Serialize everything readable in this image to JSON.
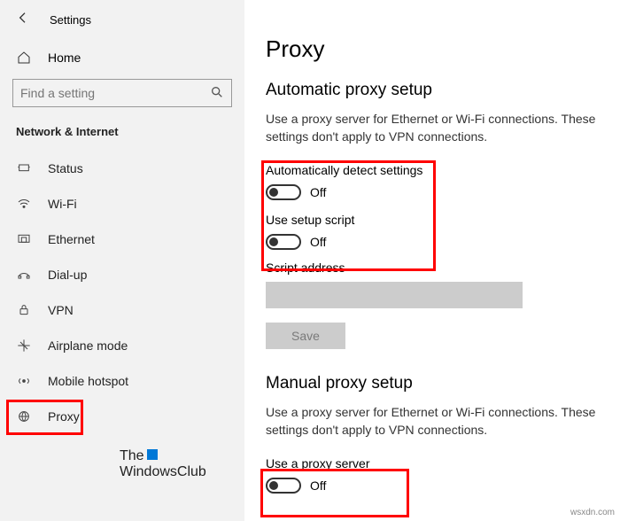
{
  "app_title": "Settings",
  "sidebar": {
    "home": "Home",
    "search_placeholder": "Find a setting",
    "section": "Network & Internet",
    "items": [
      {
        "label": "Status"
      },
      {
        "label": "Wi-Fi"
      },
      {
        "label": "Ethernet"
      },
      {
        "label": "Dial-up"
      },
      {
        "label": "VPN"
      },
      {
        "label": "Airplane mode"
      },
      {
        "label": "Mobile hotspot"
      },
      {
        "label": "Proxy"
      }
    ]
  },
  "main": {
    "title": "Proxy",
    "auto_section": "Automatic proxy setup",
    "auto_desc": "Use a proxy server for Ethernet or Wi-Fi connections. These settings don't apply to VPN connections.",
    "auto_detect_label": "Automatically detect settings",
    "auto_detect_state": "Off",
    "use_script_label": "Use setup script",
    "use_script_state": "Off",
    "script_address_label": "Script address",
    "save_label": "Save",
    "manual_section": "Manual proxy setup",
    "manual_desc": "Use a proxy server for Ethernet or Wi-Fi connections. These settings don't apply to VPN connections.",
    "use_proxy_label": "Use a proxy server",
    "use_proxy_state": "Off"
  },
  "watermark": {
    "line1": "The",
    "line2": "WindowsClub"
  },
  "footer": "wsxdn.com"
}
